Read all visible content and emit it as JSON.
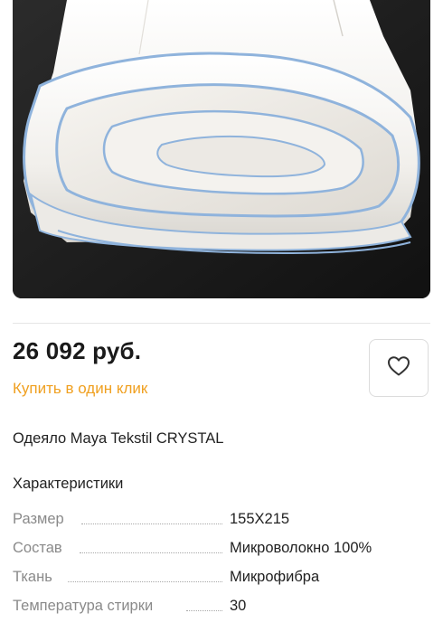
{
  "product": {
    "price": "26 092 руб.",
    "one_click_label": "Купить в один клик",
    "name": "Одеяло Maya Tekstil CRYSTAL"
  },
  "favorite": {
    "icon": "heart-icon"
  },
  "specs": {
    "heading": "Характеристики",
    "rows": [
      {
        "key": "Размер",
        "value": "155X215"
      },
      {
        "key": "Состав",
        "value": "Микроволокно 100%"
      },
      {
        "key": "Ткань",
        "value": "Микрофибра"
      },
      {
        "key": "Температура стирки",
        "value": "30"
      }
    ]
  },
  "colors": {
    "accent": "#f0a020",
    "piping": "#8fb3dc",
    "photo_background": "#1f1f1f"
  }
}
